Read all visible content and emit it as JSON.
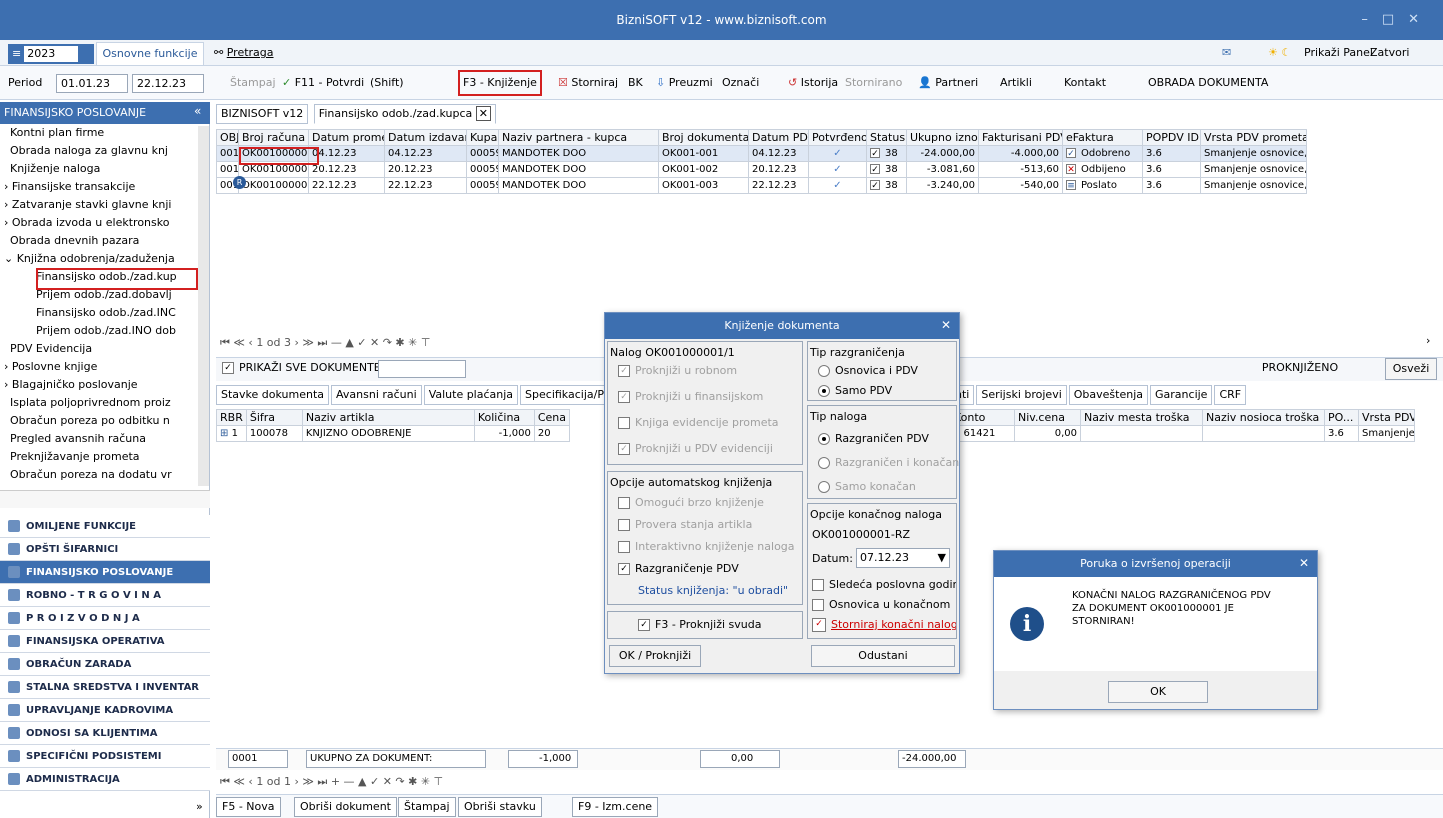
{
  "window": {
    "title": "BizniSOFT v12 - www.biznisoft.com"
  },
  "menubar": {
    "year": "2023",
    "tab_basic": "Osnovne funkcije",
    "search": "Pretraga",
    "show_panel": "Prikaži Panel",
    "close_forms": "Zatvori forme"
  },
  "toolbar": {
    "period_label": "Period",
    "date_from": "01.01.23",
    "date_to": "22.12.23",
    "print": "Štampaj",
    "confirm": "F11 - Potvrdi",
    "shift": "(Shift)",
    "post": "F3 - Knjiženje",
    "cancel": "Storniraj",
    "bk": "BK",
    "fetch": "Preuzmi",
    "mark": "Označi",
    "history": "Istorija",
    "cancelled": "Stornirano",
    "partners": "Partneri",
    "articles": "Artikli",
    "contact": "Kontakt",
    "processing": "OBRADA DOKUMENTA"
  },
  "sidebar": {
    "header": "FINANSIJSKO POSLOVANJE",
    "collapse": "«",
    "tree": [
      "Kontni plan firme",
      "Obrada naloga za glavnu knj",
      "Knjiženje naloga",
      "Finansijske transakcije",
      "Zatvaranje stavki glavne knji",
      "Obrada izvoda u elektronsko",
      "Obrada dnevnih pazara",
      "Knjižna odobrenja/zaduženja",
      "Finansijsko odob./zad.kup",
      "Prijem odob./zad.dobavlj",
      "Finansijsko odob./zad.INC",
      "Prijem odob./zad.INO dob",
      "PDV Evidencija",
      "Poslovne knjige",
      "Blagajničko poslovanje",
      "Isplata poljoprivrednom proiz",
      "Obračun poreza po odbitku n",
      "Pregled avansnih računa",
      "Preknjižavanje prometa",
      "Obračun poreza na dodatu vr"
    ],
    "modules": [
      "OMILJENE FUNKCIJE",
      "OPŠTI ŠIFARNICI",
      "FINANSIJSKO POSLOVANJE",
      "ROBNO - T R G O V I N A",
      "P R O I Z V O D N J A",
      "FINANSIJSKA OPERATIVA",
      "OBRAČUN ZARADA",
      "STALNA SREDSTVA I INVENTAR",
      "UPRAVLJANJE KADROVIMA",
      "ODNOSI SA KLIJENTIMA",
      "SPECIFIČNI PODSISTEMI",
      "ADMINISTRACIJA"
    ]
  },
  "doctabs": [
    "BIZNISOFT v12",
    "Finansijsko odob./zad.kupca"
  ],
  "grid1": {
    "headers": [
      "OBJ",
      "Broj računa",
      "Datum prometa",
      "Datum izdavanja",
      "Kupac",
      "Naziv partnera - kupca",
      "Broj dokumenta",
      "Datum PDV",
      "Potvrđeno",
      "Status",
      "Ukupno iznos",
      "Fakturisani PDV",
      "eFaktura",
      "POPDV ID",
      "Vrsta PDV prometa"
    ],
    "rows": [
      [
        "001",
        "OK001000001",
        "04.12.23",
        "04.12.23",
        "00059",
        "MANDOTEK DOO",
        "OK001-001",
        "04.12.23",
        "✓",
        "38",
        "-24.000,00",
        "-4.000,00",
        "Odobreno",
        "3.6",
        "Smanjenje osnovice, odnos"
      ],
      [
        "001",
        "OK001000002",
        "20.12.23",
        "20.12.23",
        "00059",
        "MANDOTEK DOO",
        "OK001-002",
        "20.12.23",
        "✓",
        "38",
        "-3.081,60",
        "-513,60",
        "Odbijeno",
        "3.6",
        "Smanjenje osnovice, odnos"
      ],
      [
        "001",
        "OK001000003",
        "22.12.23",
        "22.12.23",
        "00059",
        "MANDOTEK DOO",
        "OK001-003",
        "22.12.23",
        "✓",
        "38",
        "-3.240,00",
        "-540,00",
        "Poslato",
        "3.6",
        "Smanjenje osnovice, odnos"
      ]
    ]
  },
  "nav1": "1 od 3",
  "filter": {
    "show_all": "PRIKAŽI SVE DOKUMENTE",
    "status": "PROKNJIŽENO",
    "refresh": "Osveži"
  },
  "subtabs": [
    "Stavke dokumenta",
    "Avansni računi",
    "Valute plaćanja",
    "Specifikacija/POS",
    "nti",
    "Serijski brojevi",
    "Obaveštenja",
    "Garancije",
    "CRF"
  ],
  "grid2": {
    "headers": [
      "RBR",
      "Šifra",
      "Naziv artikla",
      "Količina",
      "Cena"
    ],
    "headers_right": [
      "Konto",
      "Niv.cena",
      "Naziv mesta troška",
      "Naziv nosioca troška",
      "PO...",
      "Vrsta PDV"
    ],
    "row": [
      "1",
      "100078",
      "KNJIZNO ODOBRENJE",
      "-1,000",
      "20"
    ],
    "row_right": [
      "0 61421",
      "0,00",
      "",
      "",
      "3.6",
      "Smanjenje o"
    ]
  },
  "totals": {
    "code": "0001",
    "label": "UKUPNO ZA DOKUMENT:",
    "qty": "-1,000",
    "val": "0,00",
    "sum": "-24.000,00"
  },
  "nav2": "1 od 1",
  "bottom": [
    "F5 - Nova",
    "Obriši dokument",
    "Štampaj",
    "Obriši stavku",
    "F9 - Izm.cene"
  ],
  "dialog": {
    "title": "Knjiženje dokumenta",
    "nalog": "Nalog OK001000001/1",
    "left": [
      "Proknjiži u robnom",
      "Proknjiži u finansijskom",
      "Knjiga evidencije prometa",
      "Proknjiži u PDV evidenciji"
    ],
    "auto_title": "Opcije automatskog knjiženja",
    "auto": [
      "Omogući brzo knjiženje",
      "Provera stanja artikla",
      "Interaktivno knjiženje naloga",
      "Razgraničenje PDV"
    ],
    "status": "Status knjiženja: \"u obradi\"",
    "f3": "F3 - Proknjiži svuda",
    "tip_razg": "Tip razgraničenja",
    "razg": [
      "Osnovica i PDV",
      "Samo PDV"
    ],
    "tip_naloga": "Tip naloga",
    "naloga": [
      "Razgraničen PDV",
      "Razgraničen i konačan",
      "Samo konačan"
    ],
    "konacni": "Opcije konačnog naloga",
    "konacni_id": "OK001000001-RZ",
    "datum_label": "Datum:",
    "datum": "07.12.23",
    "extra": [
      "Sledeća poslovna godina",
      "Osnovica u konačnom",
      "Storniraj konačni nalog"
    ],
    "ok": "OK / Proknjiži",
    "cancel": "Odustani"
  },
  "message": {
    "title": "Poruka o izvršenoj operaciji",
    "text": "KONAČNI NALOG RAZGRANIČENOG PDV ZA DOKUMENT OK001000001 JE STORNIRAN!",
    "ok": "OK"
  }
}
